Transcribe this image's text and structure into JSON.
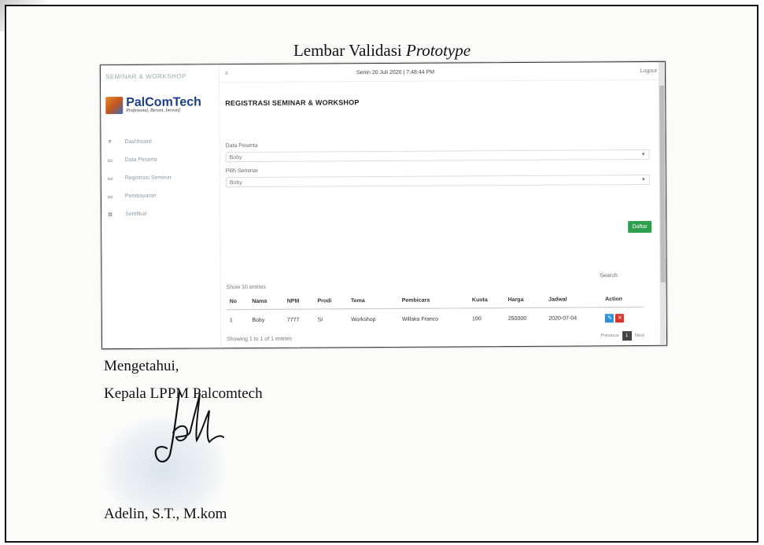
{
  "document": {
    "title_prefix": "Lembar Validasi",
    "title_italic": "Prototype",
    "acknowledged": "Mengetahui,",
    "position": "Kepala LPPM Palcomtech",
    "signer": "Adelin, S.T., M.kom"
  },
  "app": {
    "window_title": "SEMINAR & WORKSHOP",
    "logo": "PalComTech",
    "logo_tagline": "Profesional, Berani, Inovatif",
    "topbar": {
      "menu_icon": "≡",
      "datetime": "Senin 20 Juli 2020 | 7:48:44 PM",
      "logout": "Logout"
    },
    "sidebar": {
      "items": [
        {
          "icon": "≡",
          "label": "Dashboard"
        },
        {
          "icon": "▭",
          "label": "Data Peserta"
        },
        {
          "icon": "▭",
          "label": "Registrasi Seminar"
        },
        {
          "icon": "▭",
          "label": "Pembayaran"
        },
        {
          "icon": "⚙",
          "label": "Sertifikat"
        }
      ]
    },
    "page_title": "REGISTRASI SEMINAR & WORKSHOP",
    "form": {
      "peserta_label": "Data Peserta",
      "peserta_value": "Boby",
      "seminar_label": "Pilih Seminar",
      "seminar_value": "Boby",
      "submit": "Daftar"
    },
    "table": {
      "show_entries": "Show  10  entries",
      "search_label": "Search:",
      "headers": [
        "No",
        "Nama",
        "NPM",
        "Prodi",
        "Tema",
        "Pembicara",
        "Kuota",
        "Harga",
        "Jadwal",
        "Action"
      ],
      "rows": [
        {
          "no": "1",
          "nama": "Boby",
          "npm": "7777",
          "prodi": "SI",
          "tema": "Workshop",
          "pembicara": "Willaka Franco",
          "kuota": "100",
          "harga": "250000",
          "jadwal": "2020-07-04"
        }
      ],
      "info": "Showing 1 to 1 of 1 entries",
      "prev": "Previous",
      "page": "1",
      "next": "Next"
    }
  }
}
